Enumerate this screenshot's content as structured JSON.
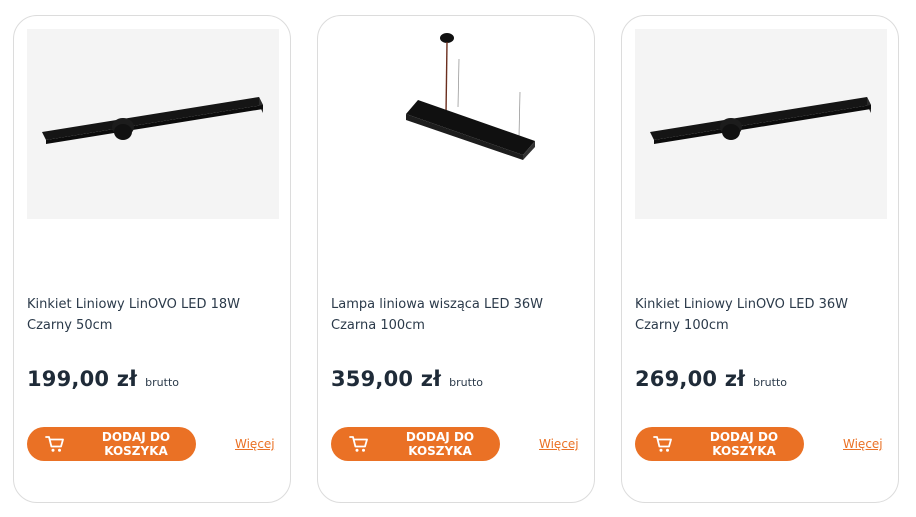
{
  "products": [
    {
      "name": "Kinkiet Liniowy LinOVO LED 18W Czarny 50cm",
      "price": "199,00 zł",
      "price_note": "brutto",
      "cart_label": "DODAJ DO KOSZYKA",
      "more_label": "Więcej",
      "image": "wall-linear-lamp"
    },
    {
      "name": "Lampa liniowa wisząca LED 36W Czarna 100cm",
      "price": "359,00 zł",
      "price_note": "brutto",
      "cart_label": "DODAJ DO KOSZYKA",
      "more_label": "Więcej",
      "image": "pendant-linear-lamp"
    },
    {
      "name": "Kinkiet Liniowy LinOVO LED 36W Czarny 100cm",
      "price": "269,00 zł",
      "price_note": "brutto",
      "cart_label": "DODAJ DO KOSZYKA",
      "more_label": "Więcej",
      "image": "wall-linear-lamp"
    }
  ],
  "colors": {
    "accent": "#ea7125",
    "text": "#2b3a4a",
    "price": "#1f2b38",
    "card_border": "#dcdcdc",
    "image_bg": "#f4f4f4"
  },
  "icons": {
    "cart": "shopping-cart-icon"
  }
}
